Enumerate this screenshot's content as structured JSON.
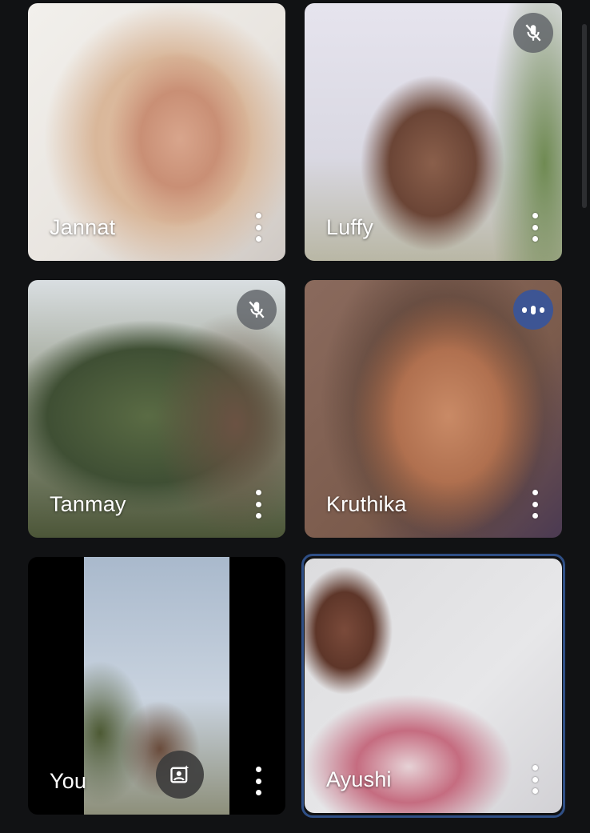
{
  "participants": [
    {
      "name": "Jannat",
      "muted": false,
      "speaking": false
    },
    {
      "name": "Luffy",
      "muted": true,
      "speaking": false
    },
    {
      "name": "Tanmay",
      "muted": true,
      "speaking": false
    },
    {
      "name": "Kruthika",
      "muted": false,
      "speaking": true
    },
    {
      "name": "You",
      "muted": false,
      "speaking": false,
      "self": true
    },
    {
      "name": "Ayushi",
      "muted": false,
      "speaking": false,
      "active_speaker": true
    }
  ],
  "icons": {
    "mute": "mic-off-icon",
    "speaking": "audio-level-icon",
    "more": "more-vert-icon",
    "effects": "visual-effects-icon"
  },
  "colors": {
    "background": "#111214",
    "speaking_badge": "#3d5594",
    "active_border": "#2f4f86"
  }
}
